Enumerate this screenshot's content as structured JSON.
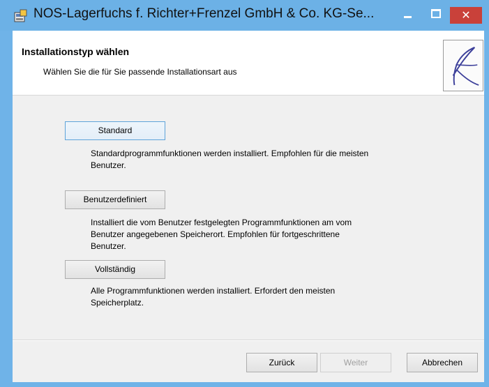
{
  "window": {
    "title": "NOS-Lagerfuchs f. Richter+Frenzel GmbH & Co. KG-Se...",
    "close_glyph": "✕",
    "accent": "#6cb1e6"
  },
  "header": {
    "title": "Installationstyp wählen",
    "subtitle": "Wählen Sie die für Sie passende Installationsart aus"
  },
  "options": [
    {
      "label": "Standard",
      "description": "Standardprogrammfunktionen werden installiert. Empfohlen für die meisten\nBenutzer."
    },
    {
      "label": "Benutzerdefiniert",
      "description": "Installiert die vom Benutzer festgelegten Programmfunktionen am vom\nBenutzer angegebenen Speicherort. Empfohlen für fortgeschrittene\nBenutzer."
    },
    {
      "label": "Vollständig",
      "description": "Alle Programmfunktionen werden installiert. Erfordert den meisten\nSpeicherplatz."
    }
  ],
  "footer": {
    "back_label": "Zurück",
    "next_label": "Weiter",
    "cancel_label": "Abbrechen"
  }
}
